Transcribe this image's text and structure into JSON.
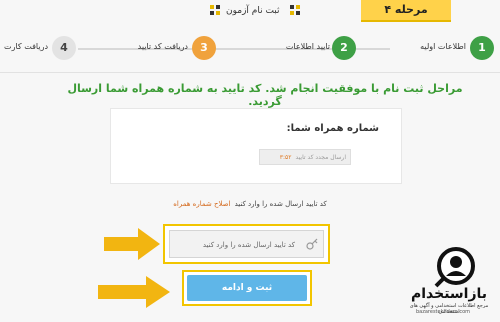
{
  "header": {
    "title": "ثبت نام آزمون",
    "stage_tag": "مرحله ۴"
  },
  "steps": [
    {
      "number": "1",
      "label": "اطلاعات اولیه",
      "status": "done",
      "color": "#3ea046"
    },
    {
      "number": "2",
      "label": "تایید اطلاعات",
      "status": "done",
      "color": "#3ea046"
    },
    {
      "number": "3",
      "label": "دریافت کد تایید",
      "status": "active",
      "color": "#f0a23c"
    },
    {
      "number": "4",
      "label": "دریافت کارت",
      "status": "pending",
      "color": "#e3e3e3"
    }
  ],
  "success_message": "مراحل ثبت نام با موفقیت انجام شد. کد تایید به شماره همراه شما ارسال گردید.",
  "card": {
    "phone_label": "شماره همراه شما:",
    "resend_label": "ارسال مجدد کد تایید",
    "timer": "۳:۵۲"
  },
  "hint": {
    "text": "کد تایید ارسال شده را وارد کنید",
    "edit_link": "اصلاح شماره همراه"
  },
  "code_input": {
    "placeholder": "کد تایید ارسال شده را وارد کنید"
  },
  "submit_label": "ثبت و ادامه",
  "watermark": {
    "brand": "بازاستخدام",
    "tagline": "مرجع اطلاعات استخدامی و آگهی های استخدامی",
    "url": "bazarestekhdam.com"
  },
  "colors": {
    "accent_green": "#3ea046",
    "accent_orange": "#f0a23c",
    "highlight_yellow": "#f2c500",
    "button_blue": "#5fb6e8"
  }
}
